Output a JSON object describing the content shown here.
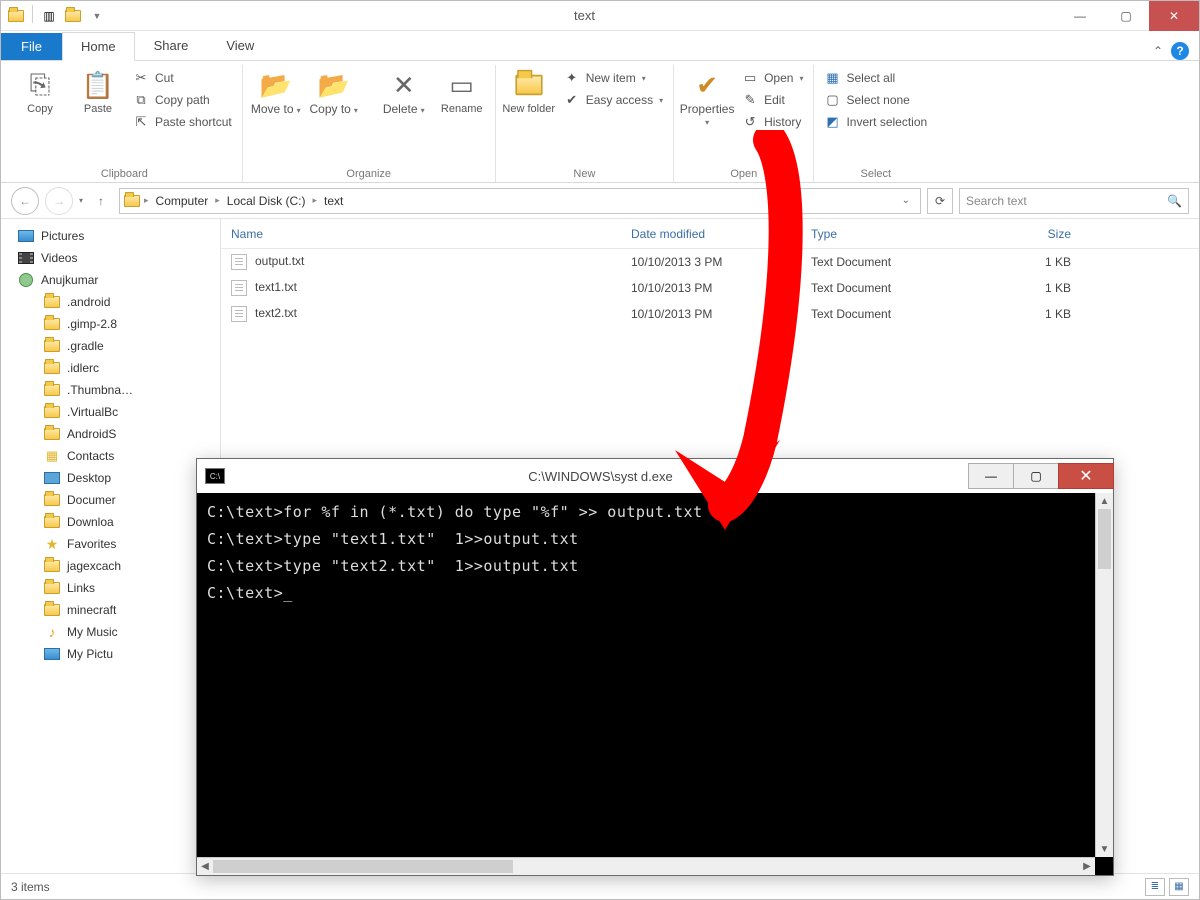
{
  "titlebar": {
    "title": "text"
  },
  "win_controls": {
    "min": "—",
    "max": "▢",
    "close": "✕"
  },
  "tabs": {
    "file": "File",
    "home": "Home",
    "share": "Share",
    "view": "View"
  },
  "ribbon": {
    "clipboard": {
      "label": "Clipboard",
      "copy": "Copy",
      "paste": "Paste",
      "cut": "Cut",
      "copy_path": "Copy path",
      "paste_shortcut": "Paste shortcut"
    },
    "organize": {
      "label": "Organize",
      "move_to": "Move to",
      "copy_to": "Copy to",
      "delete": "Delete",
      "rename": "Rename"
    },
    "new": {
      "label": "New",
      "new_folder": "New folder",
      "new_item": "New item",
      "easy_access": "Easy access"
    },
    "open": {
      "label": "Open",
      "properties": "Properties",
      "open": "Open",
      "edit": "Edit",
      "history": "History"
    },
    "select": {
      "label": "Select",
      "select_all": "Select all",
      "select_none": "Select none",
      "invert": "Invert selection"
    }
  },
  "breadcrumbs": [
    "Computer",
    "Local Disk (C:)",
    "text"
  ],
  "search": {
    "placeholder": "Search text"
  },
  "sidebar": [
    {
      "label": "Pictures",
      "icon": "pic",
      "lvl": 0
    },
    {
      "label": "Videos",
      "icon": "vid",
      "lvl": 0
    },
    {
      "label": "Anujkumar",
      "icon": "user",
      "lvl": 0
    },
    {
      "label": ".android",
      "icon": "folder",
      "lvl": 1
    },
    {
      "label": ".gimp-2.8",
      "icon": "folder",
      "lvl": 1
    },
    {
      "label": ".gradle",
      "icon": "folder",
      "lvl": 1
    },
    {
      "label": ".idlerc",
      "icon": "folder",
      "lvl": 1
    },
    {
      "label": ".Thumbna…",
      "icon": "folder",
      "lvl": 1
    },
    {
      "label": ".VirtualBc",
      "icon": "folder",
      "lvl": 1
    },
    {
      "label": "AndroidS",
      "icon": "folder",
      "lvl": 1
    },
    {
      "label": "Contacts",
      "icon": "contacts",
      "lvl": 1
    },
    {
      "label": "Desktop",
      "icon": "desk",
      "lvl": 1
    },
    {
      "label": "Documer",
      "icon": "folder",
      "lvl": 1
    },
    {
      "label": "Downloa",
      "icon": "folder",
      "lvl": 1
    },
    {
      "label": "Favorites",
      "icon": "fav",
      "lvl": 1
    },
    {
      "label": "jagexcach",
      "icon": "folder",
      "lvl": 1
    },
    {
      "label": "Links",
      "icon": "folder",
      "lvl": 1
    },
    {
      "label": "minecraft",
      "icon": "folder",
      "lvl": 1
    },
    {
      "label": "My Music",
      "icon": "music",
      "lvl": 1
    },
    {
      "label": "My Pictu",
      "icon": "pic",
      "lvl": 1
    }
  ],
  "columns": {
    "name": "Name",
    "date": "Date modified",
    "type": "Type",
    "size": "Size"
  },
  "files": [
    {
      "name": "output.txt",
      "date": "10/10/2013 3     PM",
      "type": "Text Document",
      "size": "1 KB"
    },
    {
      "name": "text1.txt",
      "date": "10/10/2013       PM",
      "type": "Text Document",
      "size": "1 KB"
    },
    {
      "name": "text2.txt",
      "date": "10/10/2013      PM",
      "type": "Text Document",
      "size": "1 KB"
    }
  ],
  "status": {
    "items": "3 items"
  },
  "cmd": {
    "title": "C:\\WINDOWS\\syst           d.exe",
    "lines": [
      "C:\\text>for %f in (*.txt) do type \"%f\" >> output.txt",
      "",
      "C:\\text>type \"text1.txt\"  1>>output.txt",
      "",
      "C:\\text>type \"text2.txt\"  1>>output.txt",
      "",
      "C:\\text>_"
    ]
  }
}
